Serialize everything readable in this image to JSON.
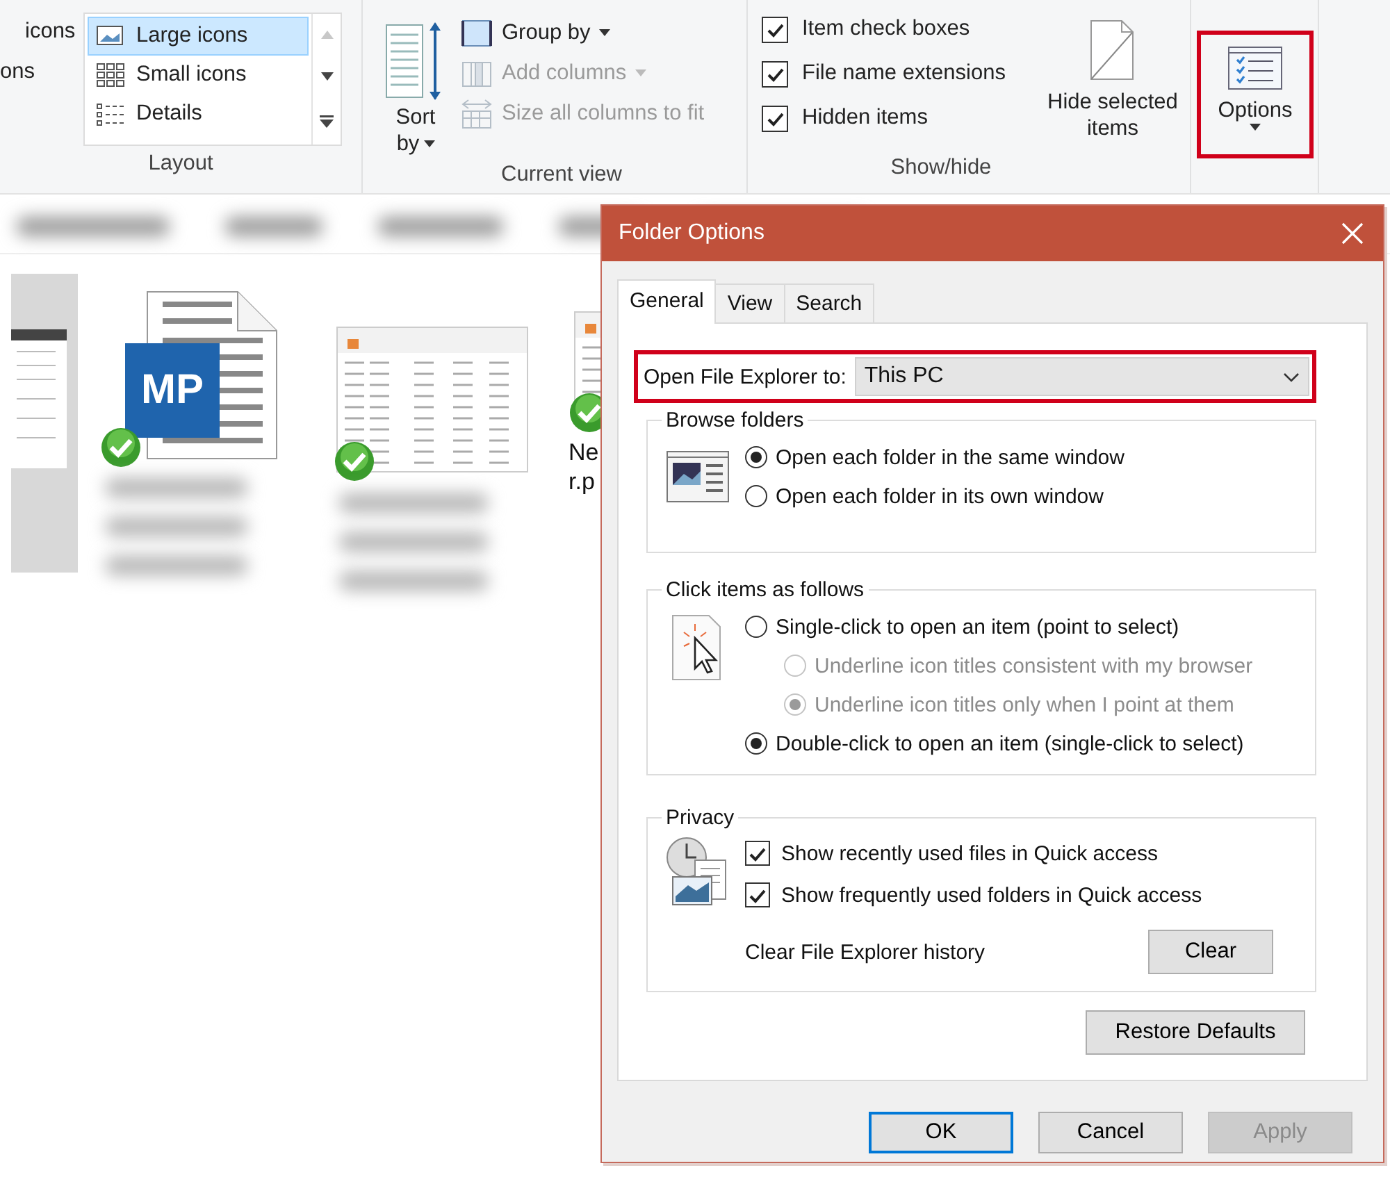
{
  "ribbon": {
    "layout": {
      "cut_items": [
        "icons",
        "ons"
      ],
      "items": [
        {
          "label": "Large icons",
          "selected": true
        },
        {
          "label": "Small icons",
          "selected": false
        },
        {
          "label": "Details",
          "selected": false
        }
      ],
      "label": "Layout"
    },
    "current_view": {
      "sort": [
        "Sort",
        "by"
      ],
      "commands": [
        {
          "label": "Group by",
          "disabled": false,
          "dropdown": true
        },
        {
          "label": "Add columns",
          "disabled": true,
          "dropdown": true
        },
        {
          "label": "Size all columns to fit",
          "disabled": true,
          "dropdown": false
        }
      ],
      "label": "Current view"
    },
    "show_hide": {
      "checkboxes": [
        {
          "label": "Item check boxes",
          "checked": true
        },
        {
          "label": "File name extensions",
          "checked": true
        },
        {
          "label": "Hidden items",
          "checked": true
        }
      ],
      "hide_selected": "Hide selected items",
      "label": "Show/hide"
    },
    "options": {
      "label": "Options",
      "highlighted": true
    }
  },
  "files": [
    {
      "kind": "partial",
      "synced": false
    },
    {
      "kind": "document",
      "synced": true,
      "logo": "MP"
    },
    {
      "kind": "screenshot",
      "synced": true
    },
    {
      "kind": "screenshot",
      "synced": true,
      "name_lines": [
        "Ne",
        "r.p"
      ]
    }
  ],
  "dialog": {
    "title": "Folder Options",
    "tabs": [
      {
        "label": "General",
        "selected": true
      },
      {
        "label": "View",
        "selected": false
      },
      {
        "label": "Search",
        "selected": false
      }
    ],
    "open_to": {
      "label": "Open File Explorer to:",
      "value": "This PC",
      "highlighted": true
    },
    "browse_folders": {
      "legend": "Browse folders",
      "options": [
        {
          "label": "Open each folder in the same window",
          "selected": true,
          "disabled": false
        },
        {
          "label": "Open each folder in its own window",
          "selected": false,
          "disabled": false
        }
      ]
    },
    "click_items": {
      "legend": "Click items as follows",
      "options": [
        {
          "label": "Single-click to open an item (point to select)",
          "selected": false,
          "disabled": false,
          "children": [
            {
              "label": "Underline icon titles consistent with my browser",
              "selected": false,
              "disabled": true
            },
            {
              "label": "Underline icon titles only when I point at them",
              "selected": true,
              "disabled": true
            }
          ]
        },
        {
          "label": "Double-click to open an item (single-click to select)",
          "selected": true,
          "disabled": false
        }
      ]
    },
    "privacy": {
      "legend": "Privacy",
      "checkboxes": [
        {
          "label": "Show recently used files in Quick access",
          "checked": true
        },
        {
          "label": "Show frequently used folders in Quick access",
          "checked": true
        }
      ],
      "clear_label": "Clear File Explorer history",
      "clear_button": "Clear"
    },
    "restore_button": "Restore Defaults",
    "buttons": [
      {
        "label": "OK",
        "default": true,
        "disabled": false
      },
      {
        "label": "Cancel",
        "default": false,
        "disabled": false
      },
      {
        "label": "Apply",
        "default": false,
        "disabled": true
      }
    ]
  }
}
